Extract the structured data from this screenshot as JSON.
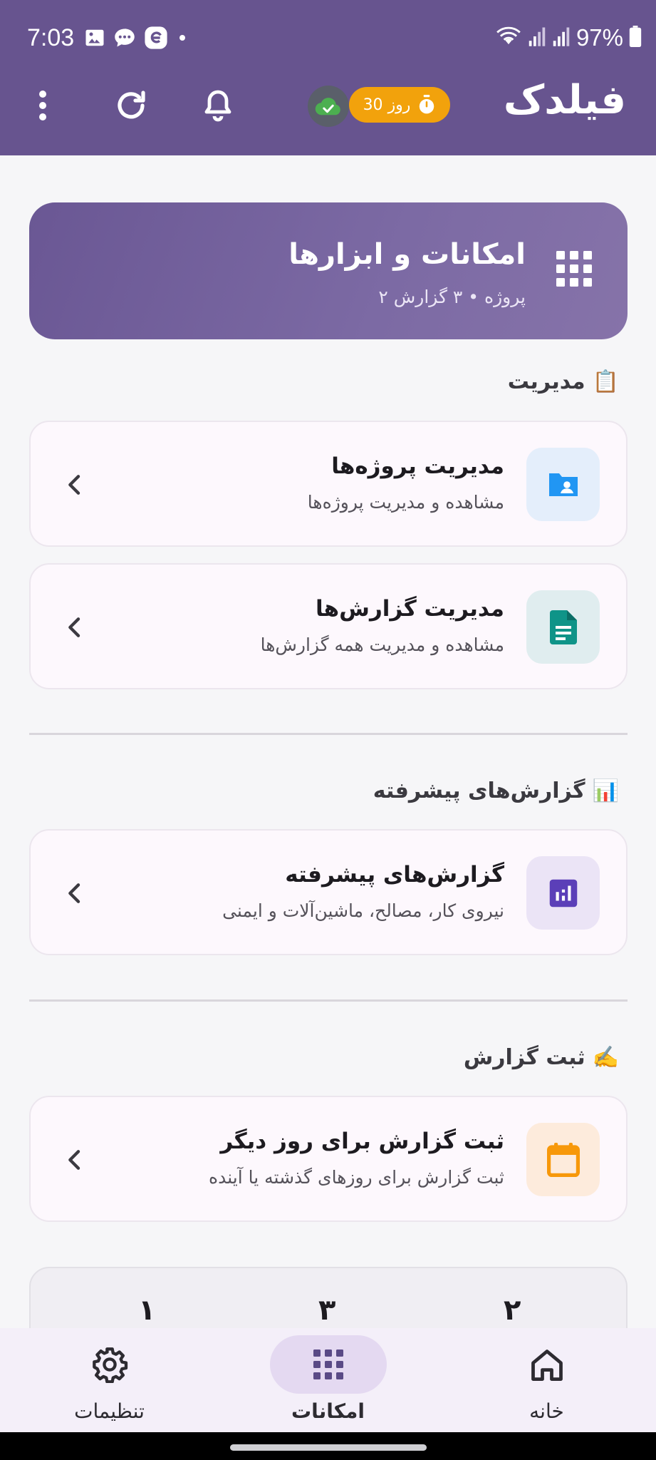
{
  "status_bar": {
    "time": "7:03",
    "battery": "97%"
  },
  "header": {
    "brand": "فیلدک",
    "days_badge": "30 روز"
  },
  "hero": {
    "title": "امکانات و ابزارها",
    "subtitle": "۲ پروژه • ۳ گزارش"
  },
  "sections": [
    {
      "emoji": "📋",
      "title": "مدیریت",
      "cards": [
        {
          "title": "مدیریت پروژه‌ها",
          "desc": "مشاهده و مدیریت پروژه‌ها",
          "icon": "folder-user-icon",
          "color": "#2196f3"
        },
        {
          "title": "مدیریت گزارش‌ها",
          "desc": "مشاهده و مدیریت همه گزارش‌ها",
          "icon": "document-icon",
          "color": "#0f9488"
        }
      ]
    },
    {
      "emoji": "📊",
      "title": "گزارش‌های پیشرفته",
      "cards": [
        {
          "title": "گزارش‌های پیشرفته",
          "desc": "نیروی کار، مصالح، ماشین‌آلات و ایمنی",
          "icon": "analytics-icon",
          "color": "#5b3fb8"
        }
      ]
    },
    {
      "emoji": "✍️",
      "title": "ثبت گزارش",
      "cards": [
        {
          "title": "ثبت گزارش برای روز دیگر",
          "desc": "ثبت گزارش برای روزهای گذشته یا آینده",
          "icon": "calendar-icon",
          "color": "#f7980a"
        }
      ]
    }
  ],
  "stats": {
    "values": [
      "۱",
      "۳",
      "۲"
    ]
  },
  "bottom_nav": [
    {
      "label": "تنظیمات",
      "icon": "gear-icon"
    },
    {
      "label": "امکانات",
      "icon": "grid-icon",
      "active": true
    },
    {
      "label": "خانه",
      "icon": "home-icon"
    }
  ],
  "colors": {
    "primary": "#67548f",
    "badge": "#f2a20c",
    "nav_active": "#e4d9f1"
  }
}
